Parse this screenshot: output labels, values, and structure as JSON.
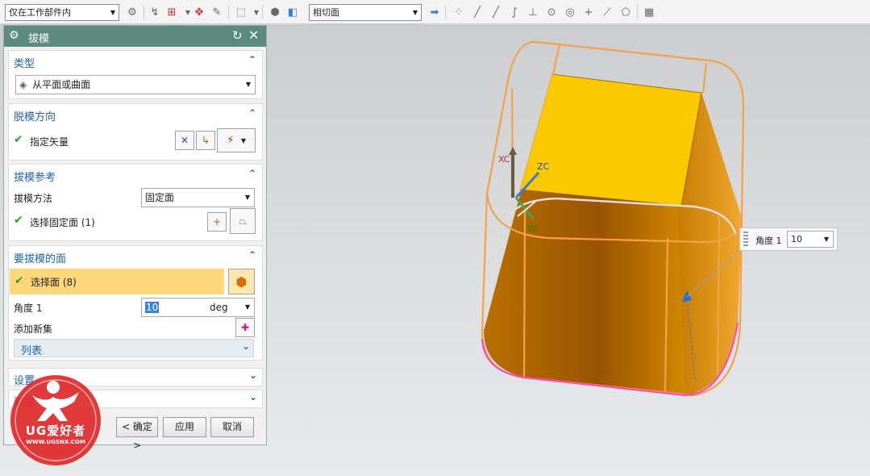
{
  "toolbar": {
    "filter_select": "仅在工作部件内",
    "surface_select": "相切面"
  },
  "dialog": {
    "title": "拔模",
    "groups": {
      "type": {
        "title": "类型",
        "value": "从平面或曲面"
      },
      "direction": {
        "title": "脱模方向",
        "vector_label": "指定矢量"
      },
      "reference": {
        "title": "拔模参考",
        "method_label": "拔模方法",
        "method_value": "固定面",
        "select_label": "选择固定面 (1)"
      },
      "faces": {
        "title": "要拔模的面",
        "select_label": "选择面 (8)",
        "angle_label": "角度 1",
        "angle_value": "10",
        "angle_unit": "deg",
        "add_set_label": "添加新集",
        "list_label": "列表"
      },
      "settings": {
        "title": "设置"
      },
      "preview": {
        "title": "预览"
      }
    },
    "buttons": {
      "ok": "< 确定 >",
      "apply": "应用",
      "cancel": "取消"
    }
  },
  "viewport": {
    "angle_label": "角度 1",
    "angle_value": "10",
    "axes": {
      "x": "XC",
      "y": "YC",
      "z": "ZC"
    }
  },
  "watermark": {
    "brand": "UG爱好者",
    "url": "WWW.UGSNX.COM"
  },
  "colors": {
    "title_bar": "#5b8a7f",
    "group_heading": "#1f62a6",
    "highlight": "#fdd77a",
    "top_face": "#fcc800",
    "side_face": "#d08000",
    "preview_outline": "#f5a04a",
    "edge_highlight": "#ff40c0",
    "watermark": "#e0282a"
  }
}
